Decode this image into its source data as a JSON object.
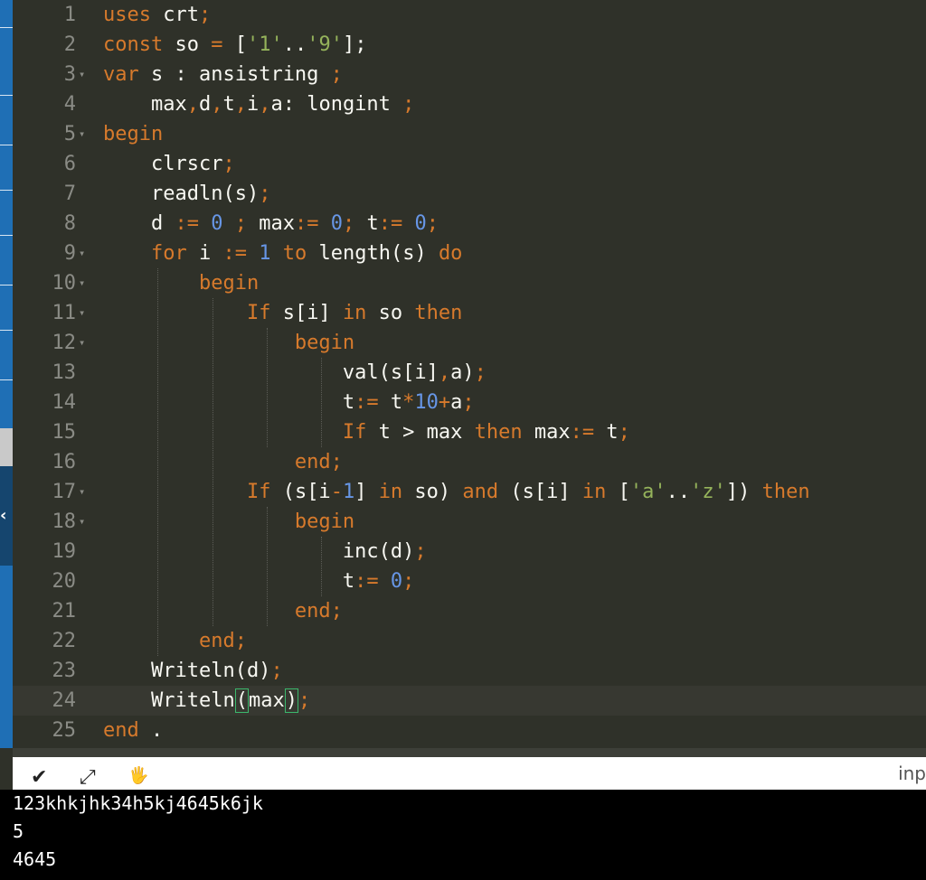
{
  "code_lines": [
    [
      {
        "t": "uses",
        "c": "k"
      },
      {
        "t": " crt",
        "c": "p"
      },
      {
        "t": ";",
        "c": "o"
      }
    ],
    [
      {
        "t": "const",
        "c": "k"
      },
      {
        "t": " so ",
        "c": "p"
      },
      {
        "t": "=",
        "c": "o"
      },
      {
        "t": " [",
        "c": "p"
      },
      {
        "t": "'1'",
        "c": "s"
      },
      {
        "t": "..",
        "c": "p"
      },
      {
        "t": "'9'",
        "c": "s"
      },
      {
        "t": "];",
        "c": "p"
      }
    ],
    [
      {
        "t": "var",
        "c": "k"
      },
      {
        "t": " s : ansistring ",
        "c": "p"
      },
      {
        "t": ";",
        "c": "o"
      }
    ],
    [
      {
        "t": "    max",
        "c": "p"
      },
      {
        "t": ",",
        "c": "o"
      },
      {
        "t": "d",
        "c": "p"
      },
      {
        "t": ",",
        "c": "o"
      },
      {
        "t": "t",
        "c": "p"
      },
      {
        "t": ",",
        "c": "o"
      },
      {
        "t": "i",
        "c": "p"
      },
      {
        "t": ",",
        "c": "o"
      },
      {
        "t": "a: longint ",
        "c": "p"
      },
      {
        "t": ";",
        "c": "o"
      }
    ],
    [
      {
        "t": "begin",
        "c": "k"
      }
    ],
    [
      {
        "t": "    clrscr",
        "c": "p"
      },
      {
        "t": ";",
        "c": "o"
      }
    ],
    [
      {
        "t": "    readln(s)",
        "c": "p"
      },
      {
        "t": ";",
        "c": "o"
      }
    ],
    [
      {
        "t": "    d ",
        "c": "p"
      },
      {
        "t": ":=",
        "c": "o"
      },
      {
        "t": " ",
        "c": "p"
      },
      {
        "t": "0",
        "c": "n"
      },
      {
        "t": " ",
        "c": "p"
      },
      {
        "t": ";",
        "c": "o"
      },
      {
        "t": " max",
        "c": "p"
      },
      {
        "t": ":=",
        "c": "o"
      },
      {
        "t": " ",
        "c": "p"
      },
      {
        "t": "0",
        "c": "n"
      },
      {
        "t": ";",
        "c": "o"
      },
      {
        "t": " t",
        "c": "p"
      },
      {
        "t": ":=",
        "c": "o"
      },
      {
        "t": " ",
        "c": "p"
      },
      {
        "t": "0",
        "c": "n"
      },
      {
        "t": ";",
        "c": "o"
      }
    ],
    [
      {
        "t": "    ",
        "c": "p"
      },
      {
        "t": "for",
        "c": "k"
      },
      {
        "t": " i ",
        "c": "p"
      },
      {
        "t": ":=",
        "c": "o"
      },
      {
        "t": " ",
        "c": "p"
      },
      {
        "t": "1",
        "c": "n"
      },
      {
        "t": " ",
        "c": "p"
      },
      {
        "t": "to",
        "c": "k"
      },
      {
        "t": " length(s) ",
        "c": "p"
      },
      {
        "t": "do",
        "c": "k"
      }
    ],
    [
      {
        "t": "        ",
        "c": "p"
      },
      {
        "t": "begin",
        "c": "k"
      }
    ],
    [
      {
        "t": "            ",
        "c": "p"
      },
      {
        "t": "If",
        "c": "k"
      },
      {
        "t": " s[i] ",
        "c": "p"
      },
      {
        "t": "in",
        "c": "k"
      },
      {
        "t": " so ",
        "c": "p"
      },
      {
        "t": "then",
        "c": "k"
      }
    ],
    [
      {
        "t": "                ",
        "c": "p"
      },
      {
        "t": "begin",
        "c": "k"
      }
    ],
    [
      {
        "t": "                    val(s[i]",
        "c": "p"
      },
      {
        "t": ",",
        "c": "o"
      },
      {
        "t": "a)",
        "c": "p"
      },
      {
        "t": ";",
        "c": "o"
      }
    ],
    [
      {
        "t": "                    t",
        "c": "p"
      },
      {
        "t": ":=",
        "c": "o"
      },
      {
        "t": " t",
        "c": "p"
      },
      {
        "t": "*",
        "c": "o"
      },
      {
        "t": "10",
        "c": "n"
      },
      {
        "t": "+",
        "c": "o"
      },
      {
        "t": "a",
        "c": "p"
      },
      {
        "t": ";",
        "c": "o"
      }
    ],
    [
      {
        "t": "                    ",
        "c": "p"
      },
      {
        "t": "If",
        "c": "k"
      },
      {
        "t": " t > max ",
        "c": "p"
      },
      {
        "t": "then",
        "c": "k"
      },
      {
        "t": " max",
        "c": "p"
      },
      {
        "t": ":=",
        "c": "o"
      },
      {
        "t": " t",
        "c": "p"
      },
      {
        "t": ";",
        "c": "o"
      }
    ],
    [
      {
        "t": "                ",
        "c": "p"
      },
      {
        "t": "end",
        "c": "k"
      },
      {
        "t": ";",
        "c": "o"
      }
    ],
    [
      {
        "t": "            ",
        "c": "p"
      },
      {
        "t": "If",
        "c": "k"
      },
      {
        "t": " (s[i",
        "c": "p"
      },
      {
        "t": "-",
        "c": "o"
      },
      {
        "t": "1",
        "c": "n"
      },
      {
        "t": "] ",
        "c": "p"
      },
      {
        "t": "in",
        "c": "k"
      },
      {
        "t": " so) ",
        "c": "p"
      },
      {
        "t": "and",
        "c": "k"
      },
      {
        "t": " (s[i] ",
        "c": "p"
      },
      {
        "t": "in",
        "c": "k"
      },
      {
        "t": " [",
        "c": "p"
      },
      {
        "t": "'a'",
        "c": "s"
      },
      {
        "t": "..",
        "c": "p"
      },
      {
        "t": "'z'",
        "c": "s"
      },
      {
        "t": "]) ",
        "c": "p"
      },
      {
        "t": "then",
        "c": "k"
      }
    ],
    [
      {
        "t": "                ",
        "c": "p"
      },
      {
        "t": "begin",
        "c": "k"
      }
    ],
    [
      {
        "t": "                    inc(d)",
        "c": "p"
      },
      {
        "t": ";",
        "c": "o"
      }
    ],
    [
      {
        "t": "                    t",
        "c": "p"
      },
      {
        "t": ":=",
        "c": "o"
      },
      {
        "t": " ",
        "c": "p"
      },
      {
        "t": "0",
        "c": "n"
      },
      {
        "t": ";",
        "c": "o"
      }
    ],
    [
      {
        "t": "                ",
        "c": "p"
      },
      {
        "t": "end",
        "c": "k"
      },
      {
        "t": ";",
        "c": "o"
      }
    ],
    [
      {
        "t": "        ",
        "c": "p"
      },
      {
        "t": "end",
        "c": "k"
      },
      {
        "t": ";",
        "c": "o"
      }
    ],
    [
      {
        "t": "    Writeln(d)",
        "c": "p"
      },
      {
        "t": ";",
        "c": "o"
      }
    ],
    [
      {
        "t": "    Writeln",
        "c": "p"
      },
      {
        "t": "(",
        "c": "br"
      },
      {
        "t": "max",
        "c": "p"
      },
      {
        "t": ")",
        "c": "br"
      },
      {
        "t": ";",
        "c": "o"
      }
    ],
    [
      {
        "t": "end",
        "c": "k"
      },
      {
        "t": " .",
        "c": "p"
      }
    ]
  ],
  "line_numbers": [
    "1",
    "2",
    "3",
    "4",
    "5",
    "6",
    "7",
    "8",
    "9",
    "10",
    "11",
    "12",
    "13",
    "14",
    "15",
    "16",
    "17",
    "18",
    "19",
    "20",
    "21",
    "22",
    "23",
    "24",
    "25"
  ],
  "fold_lines": [
    3,
    5,
    9,
    10,
    11,
    12,
    17,
    18
  ],
  "fold_marker": "▾",
  "active_line": 24,
  "console_bar": {
    "collapse_icon": "✔",
    "expand_icon": "⤢",
    "clear_icon": "🖐",
    "input_label": "inp"
  },
  "console_output": [
    "123khkjhk34h5kj4645k6jk",
    "5",
    "4645"
  ],
  "colors": {
    "keyword": "#d77a2c",
    "number": "#6796e6",
    "string": "#95b35b",
    "plain": "#f8f8f2",
    "background": "#2f3129"
  }
}
